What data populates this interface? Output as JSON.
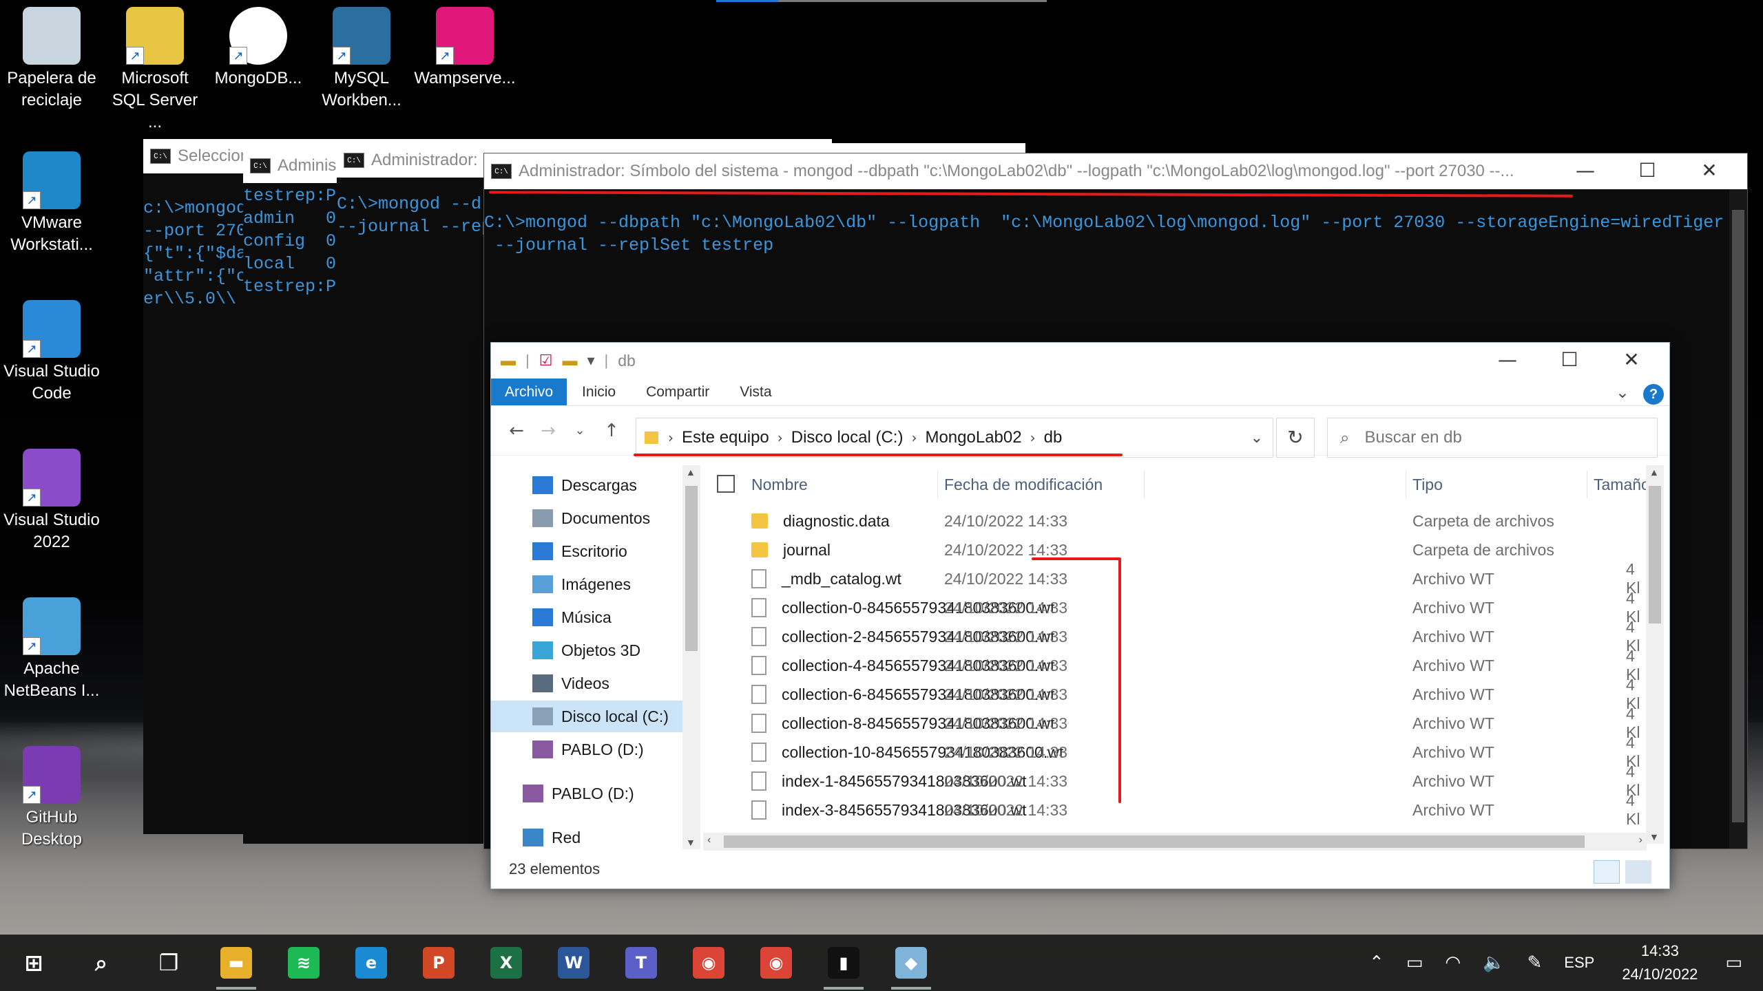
{
  "desktop_icons": [
    {
      "name": "recycle-bin",
      "label1": "Papelera de",
      "label2": "reciclaje",
      "icon": "recycle-bin-icon"
    },
    {
      "name": "sql-server",
      "label1": "Microsoft",
      "label2": "SQL Server ...",
      "icon": "sql-server-icon"
    },
    {
      "name": "mongodb",
      "label1": "MongoDB...",
      "label2": "",
      "icon": "mongodb-icon"
    },
    {
      "name": "mysql-workbench",
      "label1": "MySQL",
      "label2": "Workben...",
      "icon": "mysql-icon"
    },
    {
      "name": "wampserver",
      "label1": "Wampserve...",
      "label2": "",
      "icon": "wampserver-icon"
    },
    {
      "name": "vmware",
      "label1": "VMware",
      "label2": "Workstati...",
      "icon": "vmware-icon"
    },
    {
      "name": "vscode",
      "label1": "Visual Studio",
      "label2": "Code",
      "icon": "vscode-icon"
    },
    {
      "name": "visual-studio",
      "label1": "Visual Studio",
      "label2": "2022",
      "icon": "visual-studio-icon"
    },
    {
      "name": "netbeans",
      "label1": "Apache",
      "label2": "NetBeans I...",
      "icon": "netbeans-icon"
    },
    {
      "name": "github-desktop",
      "label1": "GitHub",
      "label2": "Desktop",
      "icon": "github-icon"
    }
  ],
  "consoles": {
    "c1": {
      "title": "Seleccion",
      "lines": "c:\\>mongod\n--port 270\n{\"t\":{\"$da\n\"attr\":{\"c\ner\\\\5.0\\\\"
    },
    "c2": {
      "title": "Adminis",
      "lines": "testrep:P\nadmin   0\nconfig  0\nlocal   0\ntestrep:P"
    },
    "c3": {
      "title": "Administrador:",
      "lines": "C:\\>mongod --d\n--journal --rep"
    },
    "c4": {
      "title": "Administrador: Símbolo del sistema - mongod  --dbpath \"c:\\MongoLab02\\db\" --logpath  \"c:\\MongoLab02\\log\\mongod.log\" --port 27030 --...",
      "lines": "C:\\>mongod --dbpath \"c:\\MongoLab02\\db\" --logpath  \"c:\\MongoLab02\\log\\mongod.log\" --port 27030 --storageEngine=wiredTiger\n --journal --replSet testrep"
    }
  },
  "explorer": {
    "title": "db",
    "ribbon": [
      "Archivo",
      "Inicio",
      "Compartir",
      "Vista"
    ],
    "breadcrumbs": [
      "Este equipo",
      "Disco local (C:)",
      "MongoLab02",
      "db"
    ],
    "search_placeholder": "Buscar en db",
    "nav": [
      {
        "label": "Descargas",
        "color": "#2a7ad5"
      },
      {
        "label": "Documentos",
        "color": "#8a9bb0"
      },
      {
        "label": "Escritorio",
        "color": "#2a7ad5"
      },
      {
        "label": "Imágenes",
        "color": "#5aa0d8"
      },
      {
        "label": "Música",
        "color": "#2a7ad5"
      },
      {
        "label": "Objetos 3D",
        "color": "#3aa6d8"
      },
      {
        "label": "Videos",
        "color": "#5a6b80"
      },
      {
        "label": "Disco local (C:)",
        "color": "#8aa0b6"
      },
      {
        "label": "PABLO (D:)",
        "color": "#8a5aa0"
      },
      {
        "label": "PABLO (D:)",
        "color": "#8a5aa0"
      },
      {
        "label": "Red",
        "color": "#3a86c8"
      }
    ],
    "columns": {
      "name": "Nombre",
      "date": "Fecha de modificación",
      "type": "Tipo",
      "size": "Tamaño"
    },
    "files": [
      {
        "name": "diagnostic.data",
        "date": "24/10/2022 14:33",
        "type": "Carpeta de archivos",
        "size": "",
        "kind": "folder"
      },
      {
        "name": "journal",
        "date": "24/10/2022 14:33",
        "type": "Carpeta de archivos",
        "size": "",
        "kind": "folder"
      },
      {
        "name": "_mdb_catalog.wt",
        "date": "24/10/2022 14:33",
        "type": "Archivo WT",
        "size": "4 Kl",
        "kind": "file"
      },
      {
        "name": "collection-0-8456557934180383600.wt",
        "date": "24/10/2022 14:33",
        "type": "Archivo WT",
        "size": "4 Kl",
        "kind": "file"
      },
      {
        "name": "collection-2-8456557934180383600.wt",
        "date": "24/10/2022 14:33",
        "type": "Archivo WT",
        "size": "4 Kl",
        "kind": "file"
      },
      {
        "name": "collection-4-8456557934180383600.wt",
        "date": "24/10/2022 14:33",
        "type": "Archivo WT",
        "size": "4 Kl",
        "kind": "file"
      },
      {
        "name": "collection-6-8456557934180383600.wt",
        "date": "24/10/2022 14:33",
        "type": "Archivo WT",
        "size": "4 Kl",
        "kind": "file"
      },
      {
        "name": "collection-8-8456557934180383600.wt",
        "date": "24/10/2022 14:33",
        "type": "Archivo WT",
        "size": "4 Kl",
        "kind": "file"
      },
      {
        "name": "collection-10-8456557934180383600.wt",
        "date": "24/10/2022 14:33",
        "type": "Archivo WT",
        "size": "4 Kl",
        "kind": "file"
      },
      {
        "name": "index-1-8456557934180383600.wt",
        "date": "24/10/2022 14:33",
        "type": "Archivo WT",
        "size": "4 Kl",
        "kind": "file"
      },
      {
        "name": "index-3-8456557934180383600.wt",
        "date": "24/10/2022 14:33",
        "type": "Archivo WT",
        "size": "4 Kl",
        "kind": "file"
      }
    ],
    "status": "23 elementos"
  },
  "taskbar": {
    "apps": [
      {
        "name": "start-button",
        "icon": "windows-icon",
        "glyph": "⊞",
        "color": "transparent"
      },
      {
        "name": "search-button",
        "icon": "search-icon",
        "glyph": "⌕",
        "color": "transparent"
      },
      {
        "name": "task-view-button",
        "icon": "task-view-icon",
        "glyph": "❐",
        "color": "transparent"
      },
      {
        "name": "taskbar-explorer",
        "icon": "folder-icon",
        "glyph": "▬",
        "color": "#e8b02a",
        "open": true
      },
      {
        "name": "taskbar-spotify",
        "icon": "spotify-icon",
        "glyph": "≋",
        "color": "#1db954"
      },
      {
        "name": "taskbar-edge",
        "icon": "edge-icon",
        "glyph": "e",
        "color": "#1a8ad4"
      },
      {
        "name": "taskbar-powerpoint",
        "icon": "powerpoint-icon",
        "glyph": "P",
        "color": "#d24726"
      },
      {
        "name": "taskbar-excel",
        "icon": "excel-icon",
        "glyph": "X",
        "color": "#1d7044"
      },
      {
        "name": "taskbar-word",
        "icon": "word-icon",
        "glyph": "W",
        "color": "#2b579a"
      },
      {
        "name": "taskbar-teams",
        "icon": "teams-icon",
        "glyph": "T",
        "color": "#5b5fc7"
      },
      {
        "name": "taskbar-chrome",
        "icon": "chrome-icon",
        "glyph": "◉",
        "color": "#db4437"
      },
      {
        "name": "taskbar-chrome-profile",
        "icon": "chrome-profile-icon",
        "glyph": "◉",
        "color": "#db4437"
      },
      {
        "name": "taskbar-cmd",
        "icon": "cmd-icon",
        "glyph": "▮",
        "color": "#111111",
        "open": true
      },
      {
        "name": "taskbar-app",
        "icon": "app-icon",
        "glyph": "◆",
        "color": "#7fb4d8",
        "open": true
      }
    ],
    "lang": "ESP",
    "time": "14:33",
    "date": "24/10/2022"
  }
}
